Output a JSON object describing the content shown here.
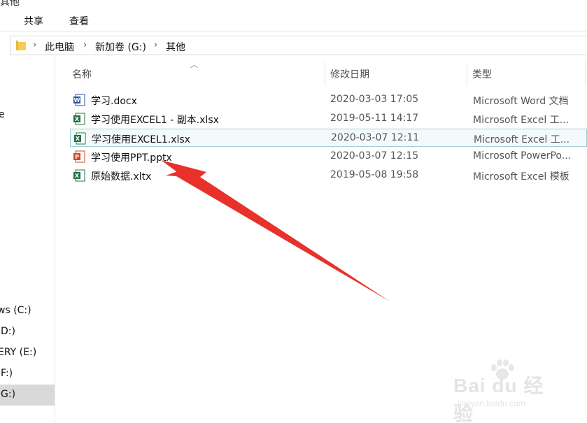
{
  "window": {
    "title_fragment": "其他"
  },
  "ribbon": {
    "tabs": [
      {
        "label": "共享"
      },
      {
        "label": "查看"
      }
    ]
  },
  "address": {
    "crumbs": [
      "此电脑",
      "新加卷 (G:)",
      "其他"
    ]
  },
  "nav": {
    "items": [
      {
        "label": "e",
        "selected": false
      },
      {
        "label": "ws (C:)",
        "selected": false
      },
      {
        "label": "D:)",
        "selected": false
      },
      {
        "label": "ERY (E:)",
        "selected": false
      },
      {
        "label": "F:)",
        "selected": false
      },
      {
        "label": "G:)",
        "selected": true
      }
    ]
  },
  "columns": {
    "name": "名称",
    "date": "修改日期",
    "type": "类型"
  },
  "files": [
    {
      "name": "学习.docx",
      "date": "2020-03-03 17:05",
      "type": "Microsoft Word 文档",
      "icon": "word-icon"
    },
    {
      "name": "学习使用EXCEL1 - 副本.xlsx",
      "date": "2019-05-11 14:17",
      "type": "Microsoft Excel 工...",
      "icon": "excel-icon"
    },
    {
      "name": "学习使用EXCEL1.xlsx",
      "date": "2020-03-07 12:11",
      "type": "Microsoft Excel 工...",
      "icon": "excel-icon"
    },
    {
      "name": "学习使用PPT.pptx",
      "date": "2020-03-07 12:15",
      "type": "Microsoft PowerPo...",
      "icon": "powerpoint-icon"
    },
    {
      "name": "原始数据.xltx",
      "date": "2019-05-08 19:58",
      "type": "Microsoft Excel 模板",
      "icon": "excel-template-icon"
    }
  ],
  "watermark": {
    "main": "Bai du 经验",
    "sub": "jingyan.baidu.com"
  },
  "colors": {
    "word": "#2b579a",
    "excel": "#217346",
    "powerpoint": "#d24726",
    "annotation_arrow": "#e8312a",
    "selection": "#d9d9d9",
    "hover_border": "#9ecfd8"
  }
}
